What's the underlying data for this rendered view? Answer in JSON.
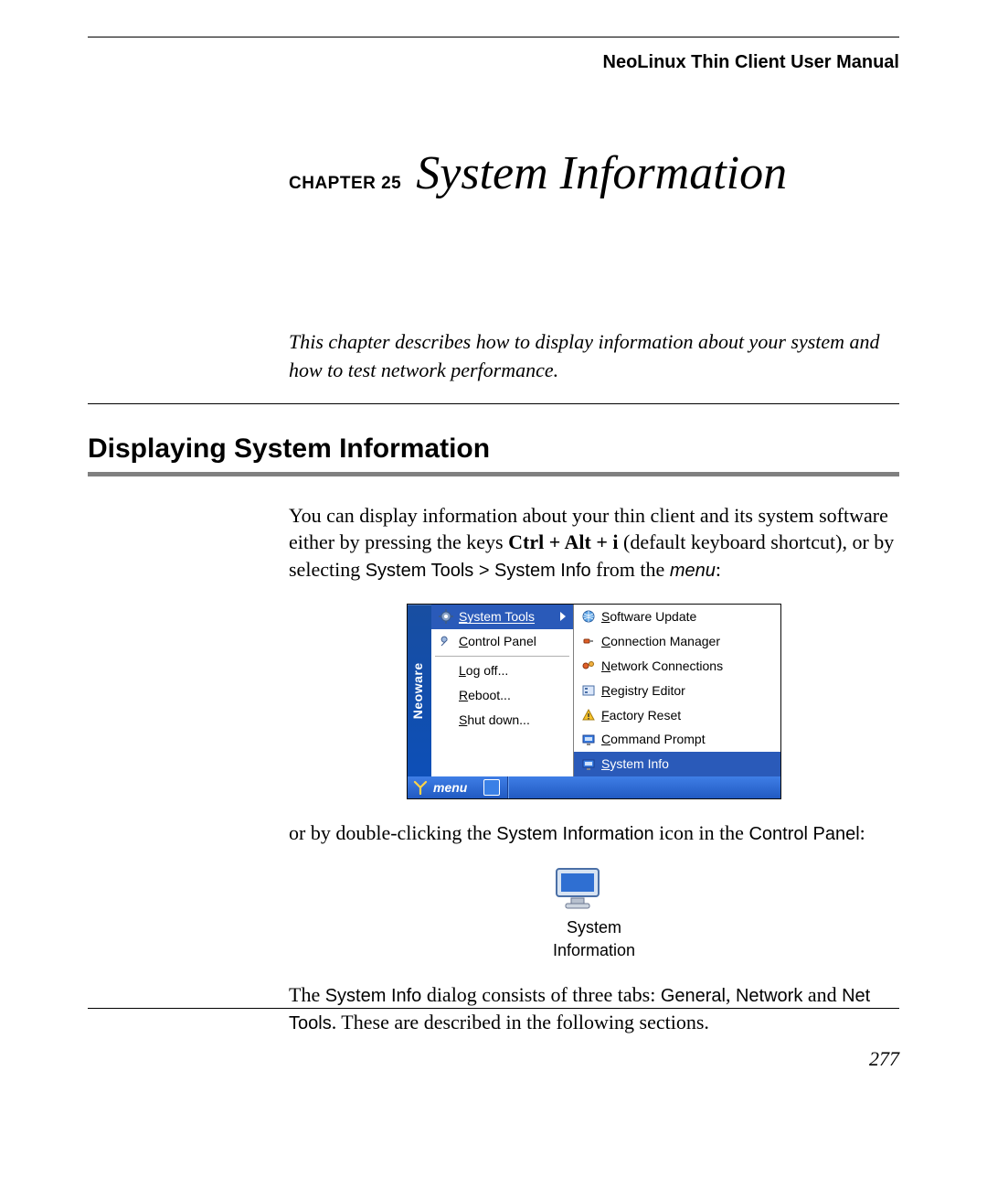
{
  "header": {
    "manual_title": "NeoLinux Thin Client User Manual"
  },
  "chapter": {
    "label": "CHAPTER 25",
    "title": "System Information"
  },
  "intro": "This chapter describes how to display information about your system and how to test network performance.",
  "section_heading": "Displaying System Information",
  "para1": {
    "pre": "You can display information about your thin client and its system software either by pressing the keys ",
    "keys": "Ctrl + Alt + i",
    "mid": " (default keyboard shortcut), or by selecting ",
    "path": "System Tools > System Info",
    "mid2": " from the ",
    "menu_word": "menu",
    "post": ":"
  },
  "menu_shot": {
    "brand": "Neoware",
    "left_items": [
      {
        "label": "System Tools",
        "accel_idx": 0,
        "icon": "gear",
        "hover": true,
        "submenu": true
      },
      {
        "label": "Control Panel",
        "accel_idx": 0,
        "icon": "wrench",
        "hover": false
      },
      {
        "label": "Log off...",
        "accel_idx": 0,
        "icon": "",
        "hover": false
      },
      {
        "label": "Reboot...",
        "accel_idx": 0,
        "icon": "",
        "hover": false
      },
      {
        "label": "Shut down...",
        "accel_idx": 0,
        "icon": "",
        "hover": false
      }
    ],
    "right_items": [
      {
        "label": "Software Update",
        "accel_idx": 0,
        "icon": "globe"
      },
      {
        "label": "Connection Manager",
        "accel_idx": 0,
        "icon": "plug"
      },
      {
        "label": "Network Connections",
        "accel_idx": 0,
        "icon": "net"
      },
      {
        "label": "Registry Editor",
        "accel_idx": 0,
        "icon": "reg"
      },
      {
        "label": "Factory Reset",
        "accel_idx": 0,
        "icon": "warn"
      },
      {
        "label": "Command Prompt",
        "accel_idx": 0,
        "icon": "monitor"
      },
      {
        "label": "System Info",
        "accel_idx": 0,
        "icon": "monitor",
        "hover": true
      }
    ],
    "taskbar": {
      "label": "menu"
    }
  },
  "para2": {
    "pre": "or by double-clicking the ",
    "name": "System Information",
    "mid": " icon in the ",
    "panel": "Control Panel",
    "post": ":"
  },
  "icon_shot": {
    "line1": "System",
    "line2": "Information"
  },
  "para3": {
    "pre": "The ",
    "name": "System Info",
    "mid": " dialog consists of three tabs: ",
    "tab1": "General",
    "sep1": ", ",
    "tab2": "Network",
    "mid2": " and ",
    "tab3": "Net Tools",
    "post": ". These are described in the following sections."
  },
  "page_number": "277"
}
